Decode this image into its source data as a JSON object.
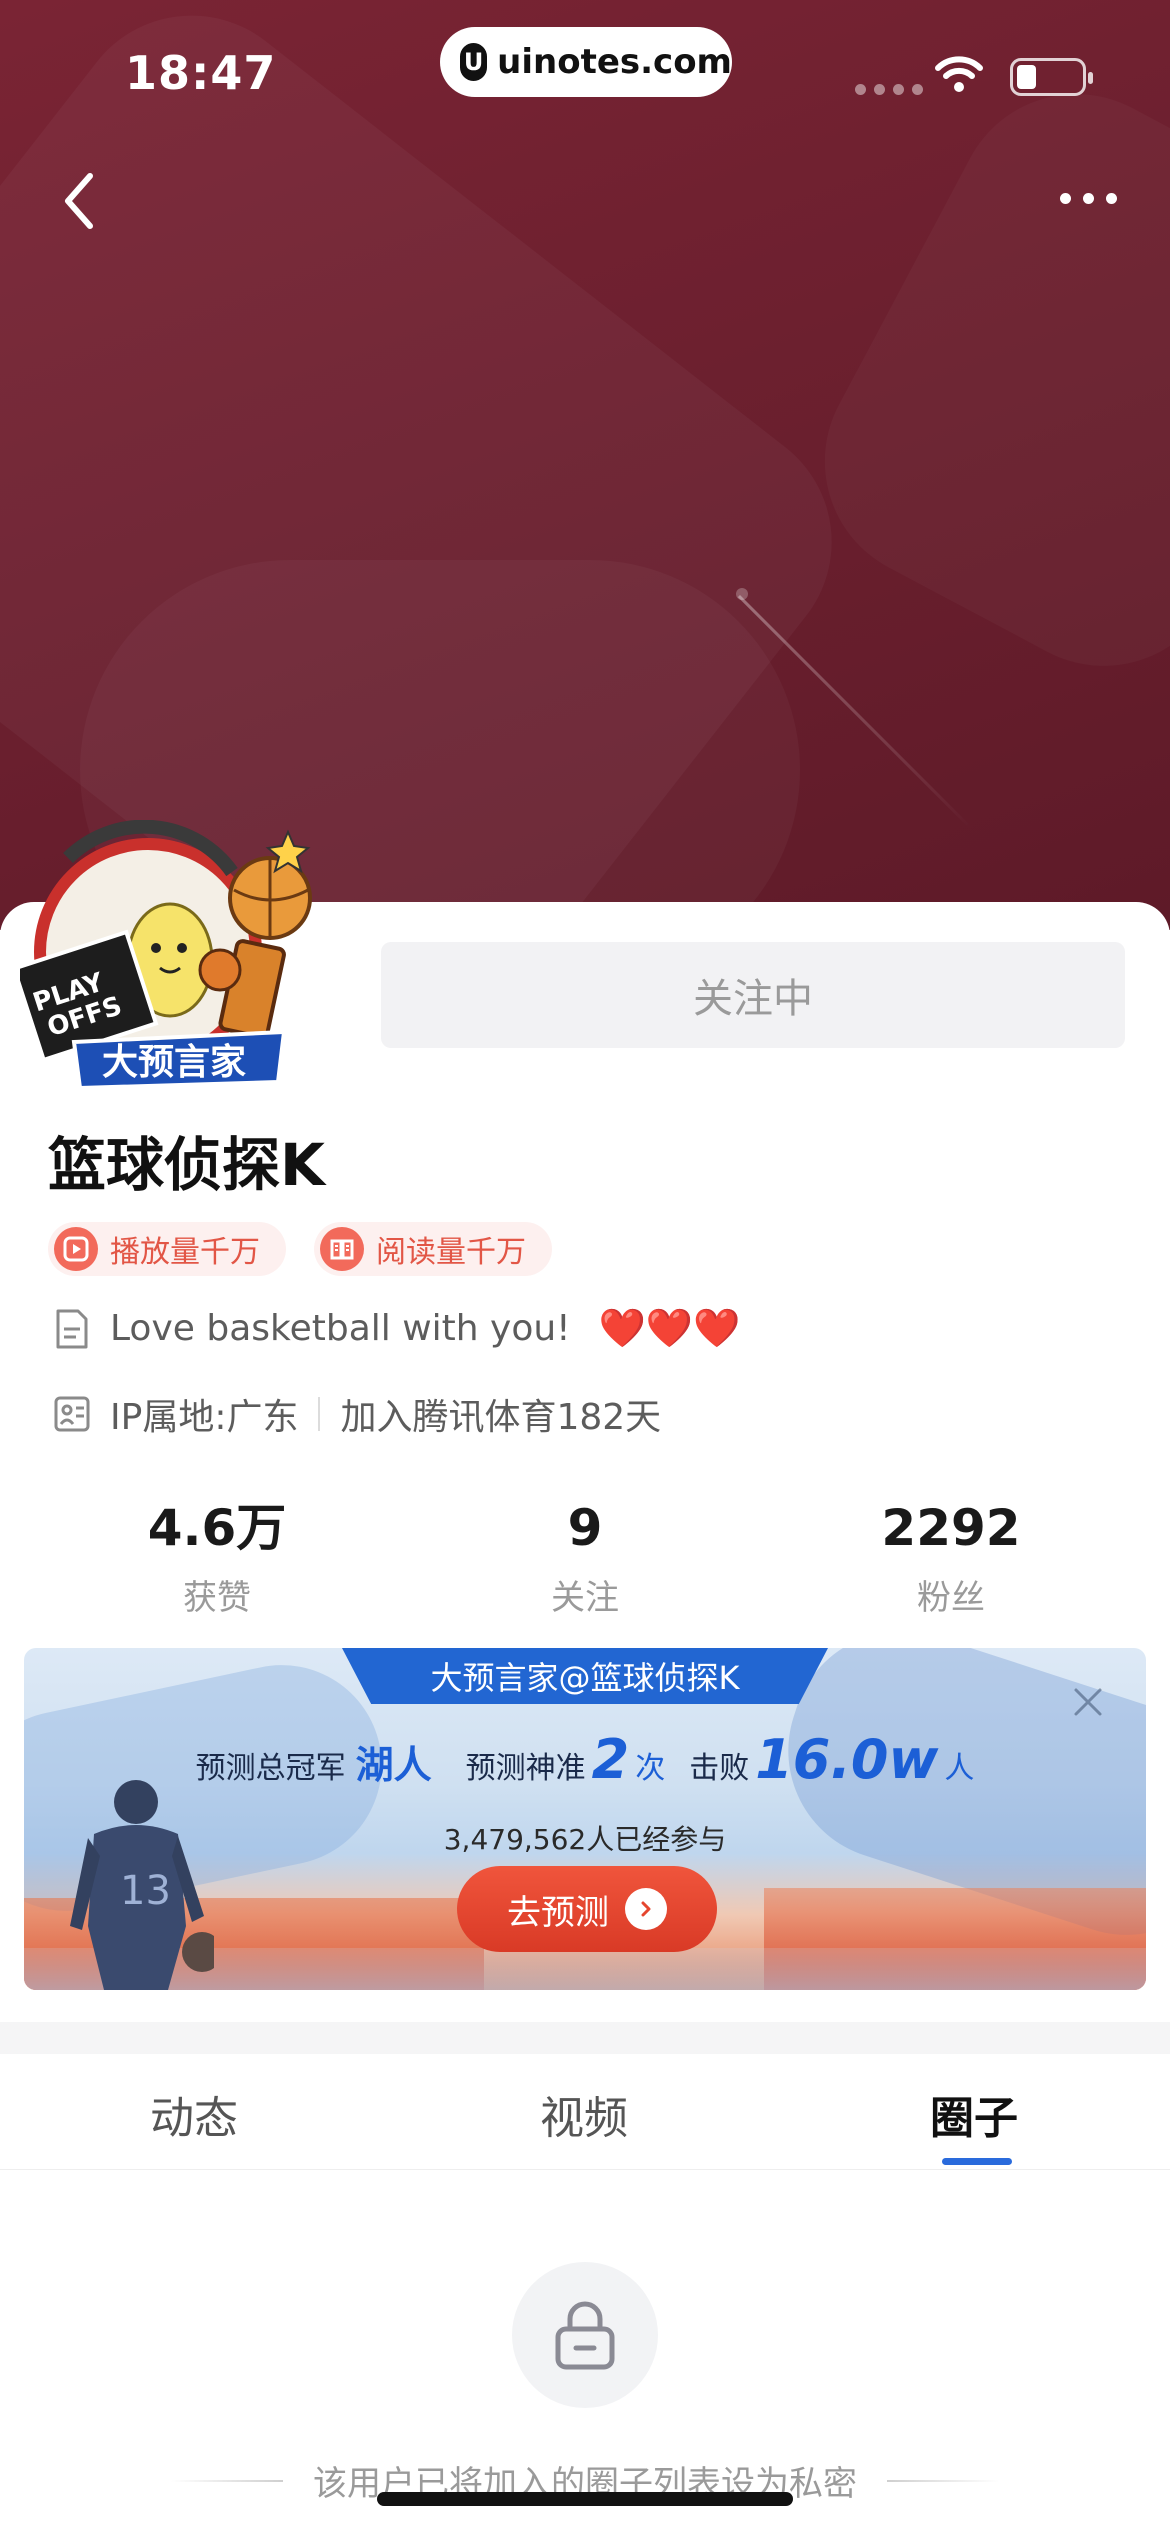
{
  "status_bar": {
    "time": "18:47",
    "url": "uinotes.com",
    "url_badge": "U"
  },
  "avatar": {
    "badge_text": "大预言家",
    "sign_text": "PLAY OFFS"
  },
  "profile": {
    "follow_label": "关注中",
    "name": "篮球侦探K",
    "tags": [
      {
        "label": "播放量千万",
        "icon": "play-icon"
      },
      {
        "label": "阅读量千万",
        "icon": "book-icon"
      }
    ],
    "bio": "Love basketball with you!",
    "bio_emoji": "❤️❤️❤️",
    "ip_location": "IP属地:广东",
    "joined": "加入腾讯体育182天"
  },
  "stats": [
    {
      "value": "4.6万",
      "label": "获赞"
    },
    {
      "value": "9",
      "label": "关注"
    },
    {
      "value": "2292",
      "label": "粉丝"
    }
  ],
  "prediction": {
    "title": "大预言家@篮球侦探K",
    "champion_label": "预测总冠军",
    "champion_team": "湖人",
    "accuracy_label": "预测神准",
    "accuracy_count": "2",
    "accuracy_unit": "次",
    "beat_label": "击败",
    "beat_value": "16.0w",
    "beat_unit": "人",
    "participants": "3,479,562人已经参与",
    "button_label": "去预测",
    "player_number": "13"
  },
  "tabs": [
    {
      "label": "动态",
      "active": false
    },
    {
      "label": "视频",
      "active": false
    },
    {
      "label": "圈子",
      "active": true
    }
  ],
  "empty_state": {
    "message": "该用户已将加入的圈子列表设为私密",
    "icon": "lock-icon"
  },
  "colors": {
    "banner": "#6e2131",
    "accent_blue": "#2a6bdc",
    "tag_red": "#e25646",
    "button_red": "#e5462f"
  }
}
